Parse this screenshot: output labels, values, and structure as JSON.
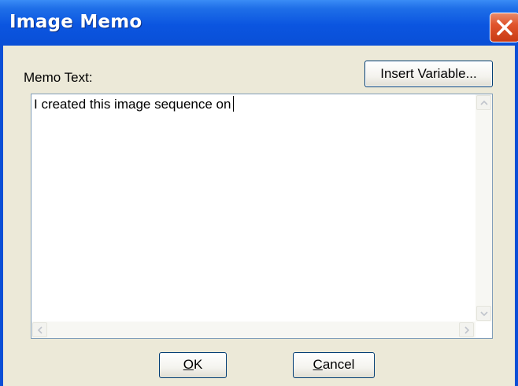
{
  "window": {
    "title": "Image Memo",
    "close_icon": "close-x-icon"
  },
  "memo": {
    "label": "Memo Text:",
    "insert_variable_label": "Insert Variable...",
    "text_value": "I created this image sequence on"
  },
  "scrollbars": {
    "up_icon": "chevron-up-icon",
    "down_icon": "chevron-down-icon",
    "left_icon": "chevron-left-icon",
    "right_icon": "chevron-right-icon"
  },
  "buttons": {
    "ok_mnemonic": "O",
    "ok_rest": "K",
    "cancel_mnemonic": "C",
    "cancel_rest": "ancel"
  },
  "colors": {
    "titlebar": "#0b55e0",
    "client_bg": "#ece9d8",
    "close_button": "#e0542c",
    "field_border": "#7f9db9"
  }
}
